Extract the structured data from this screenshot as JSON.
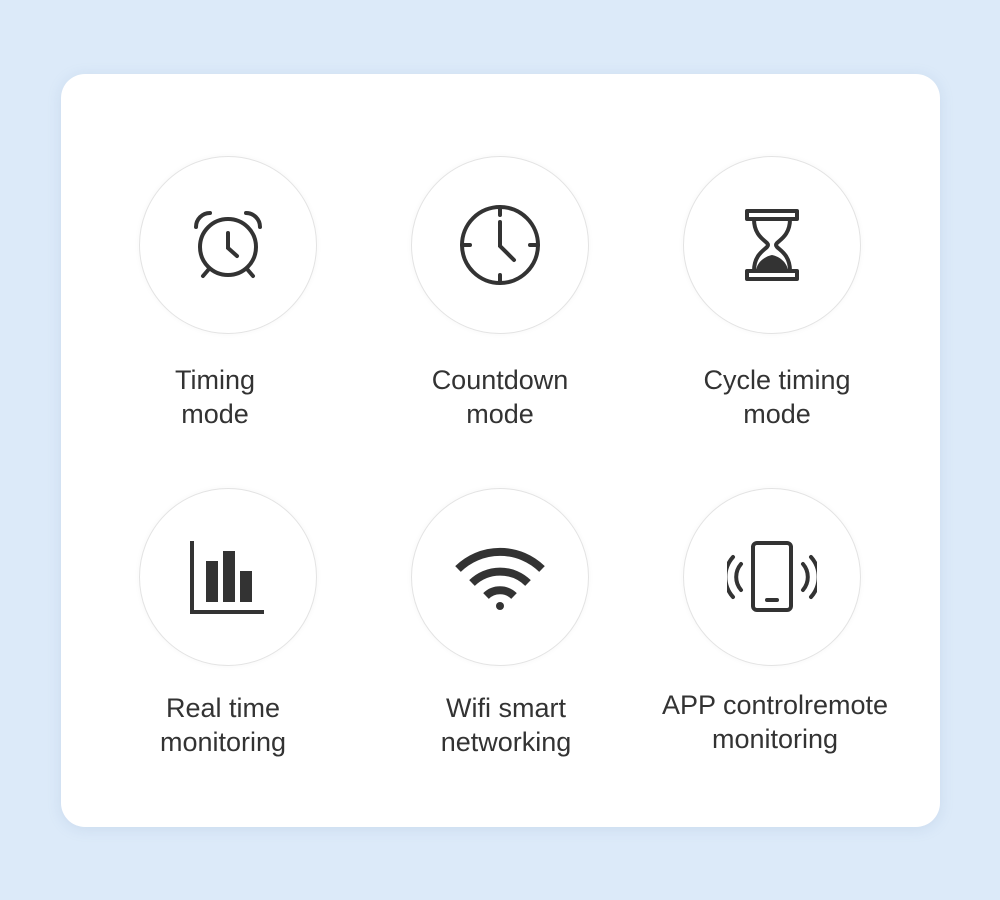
{
  "features": [
    {
      "label_line1": "Timing",
      "label_line2": "mode",
      "icon": "alarm-clock-icon"
    },
    {
      "label_line1": "Countdown",
      "label_line2": "mode",
      "icon": "clock-icon"
    },
    {
      "label_line1": "Cycle timing",
      "label_line2": "mode",
      "icon": "hourglass-icon"
    },
    {
      "label_line1": "Real time",
      "label_line2": "monitoring",
      "icon": "bar-chart-icon"
    },
    {
      "label_line1": "Wifi smart",
      "label_line2": "networking",
      "icon": "wifi-icon"
    },
    {
      "label_line1": "APP controlremote",
      "label_line2": "monitoring",
      "icon": "phone-vibrate-icon"
    }
  ],
  "colors": {
    "background": "#dceaf9",
    "card": "#ffffff",
    "icon": "#333333",
    "text": "#333333"
  }
}
